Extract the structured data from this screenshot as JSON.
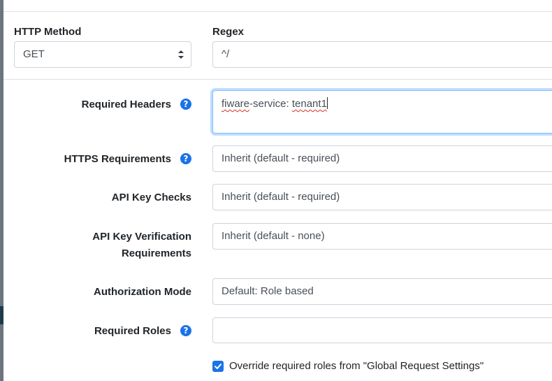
{
  "http_method": {
    "label": "HTTP Method",
    "value": "GET"
  },
  "regex": {
    "label": "Regex",
    "value": "^/"
  },
  "required_headers": {
    "label": "Required Headers",
    "value_word1": "fiware",
    "value_mid": "-service: ",
    "value_word2": "tenant1",
    "help_glyph": "?"
  },
  "https_requirements": {
    "label": "HTTPS Requirements",
    "value": "Inherit (default - required)",
    "help_glyph": "?"
  },
  "api_key_checks": {
    "label": "API Key Checks",
    "value": "Inherit (default - required)"
  },
  "api_key_verification": {
    "label_line1": "API Key Verification",
    "label_line2": "Requirements",
    "value": "Inherit (default - none)"
  },
  "authorization_mode": {
    "label": "Authorization Mode",
    "value": "Default: Role based"
  },
  "required_roles": {
    "label": "Required Roles",
    "value": "",
    "help_glyph": "?"
  },
  "override_roles": {
    "label": "Override required roles from \"Global Request Settings\"",
    "checked": true
  },
  "colors": {
    "accent": "#1a73e8",
    "focus_border": "#80bdff",
    "spellcheck": "#d93025"
  }
}
